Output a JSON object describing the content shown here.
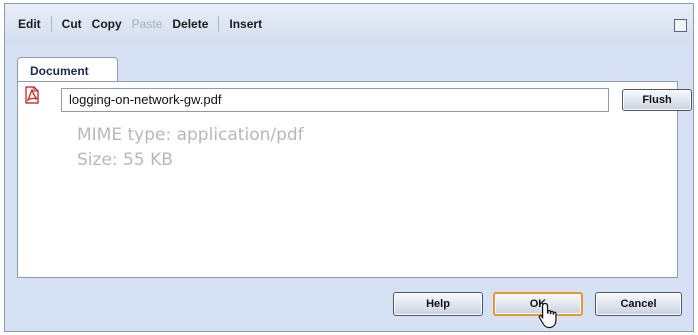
{
  "toolbar": {
    "edit": "Edit",
    "cut": "Cut",
    "copy": "Copy",
    "paste": "Paste",
    "delete": "Delete",
    "insert": "Insert"
  },
  "tabs": [
    {
      "label": "Document",
      "active": true
    }
  ],
  "document": {
    "filename": "logging-on-network-gw.pdf",
    "mime_type": "MIME type: application/pdf",
    "size": "Size: 55 KB",
    "file_icon": "pdf-icon",
    "flush_label": "Flush"
  },
  "buttons": {
    "help": "Help",
    "ok": "OK",
    "cancel": "Cancel"
  },
  "colors": {
    "dialog_background": "#d6e1f4",
    "panel_border": "#8c9ab3",
    "default_button_border": "#e8962f",
    "disabled_text": "#a3aec0",
    "info_text": "#b8b8b8"
  }
}
